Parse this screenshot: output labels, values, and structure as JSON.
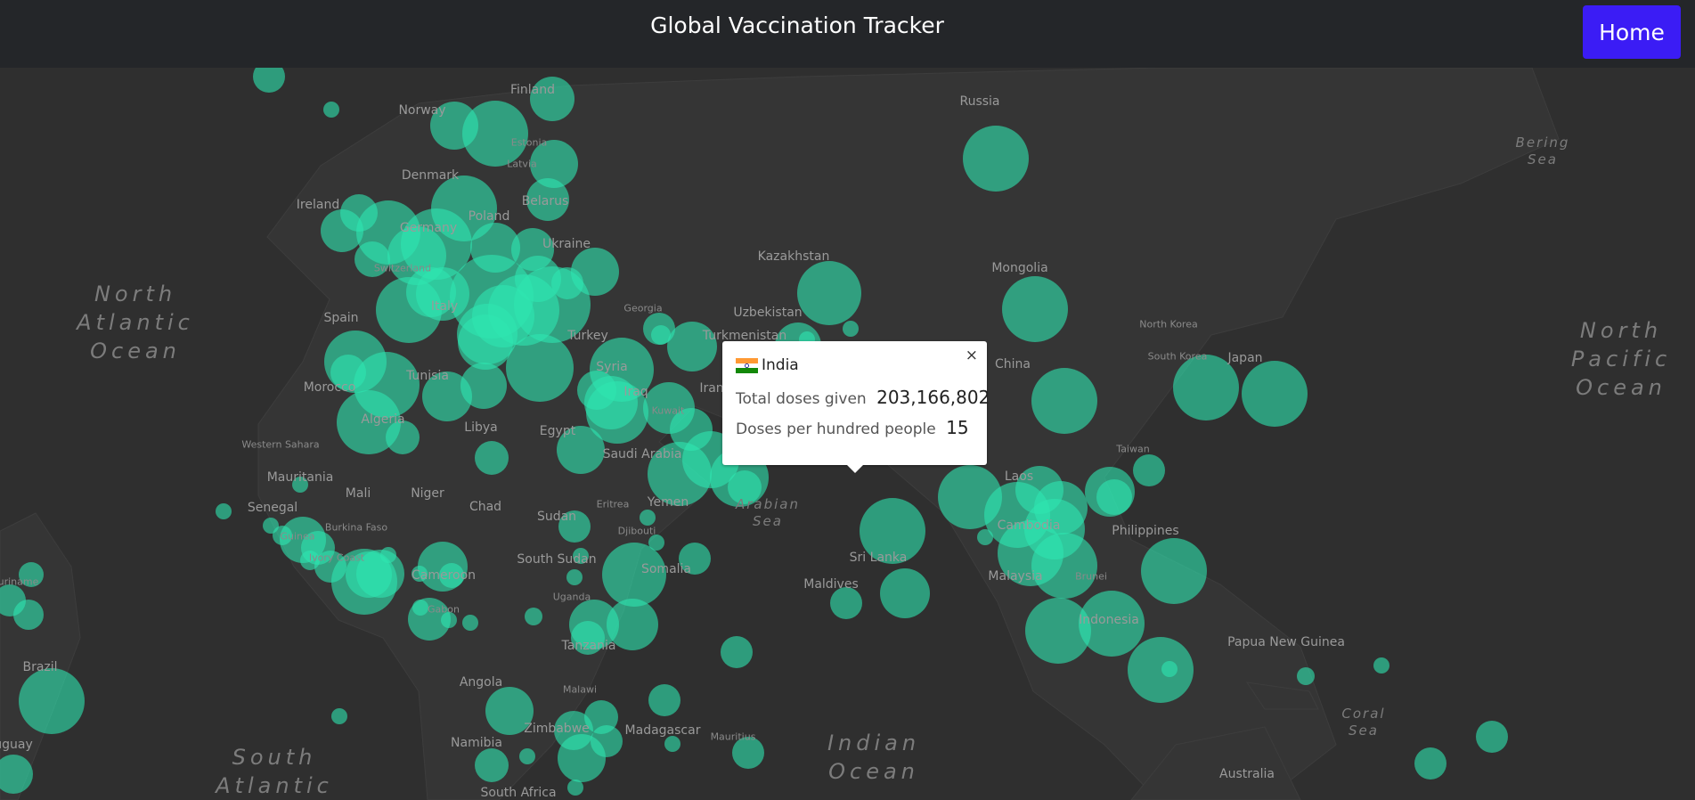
{
  "header": {
    "title": "Global Vaccination Tracker",
    "home_label": "Home"
  },
  "colors": {
    "bubble": "#2ee6b0",
    "accent": "#3b1cf5",
    "map_background": "#2f2f2f",
    "header_background": "#242629"
  },
  "map": {
    "country_labels": [
      "Finland",
      "Norway",
      "Estonia",
      "Latvia",
      "Denmark",
      "Belarus",
      "Ireland",
      "Poland",
      "Germany",
      "Ukraine",
      "Switzerland",
      "Italy",
      "Spain",
      "Georgia",
      "Turkey",
      "Turkmenistan",
      "Uzbekistan",
      "Kazakhstan",
      "Russia",
      "Mongolia",
      "China",
      "North Korea",
      "South Korea",
      "Japan",
      "Taiwan",
      "Morocco",
      "Tunisia",
      "Algeria",
      "Libya",
      "Egypt",
      "Syria",
      "Iraq",
      "Iran",
      "Kuwait",
      "Saudi Arabia",
      "Western Sahara",
      "Mauritania",
      "Mali",
      "Niger",
      "Chad",
      "Sudan",
      "Eritrea",
      "Yemen",
      "Djibouti",
      "Senegal",
      "Burkina Faso",
      "Guinea",
      "Ivory Coast",
      "Cameroon",
      "Gabon",
      "South Sudan",
      "Somalia",
      "Uganda",
      "Tanzania",
      "Malawi",
      "Angola",
      "Namibia",
      "Zimbabwe",
      "Madagascar",
      "Mauritius",
      "South Africa",
      "Brazil",
      "Suriname",
      "Uruguay",
      "Sri Lanka",
      "Maldives",
      "Laos",
      "Cambodia",
      "Malaysia",
      "Brunei",
      "Philippines",
      "Indonesia",
      "Papua New Guinea",
      "Australia"
    ],
    "ocean_labels": [
      "North Atlantic Ocean",
      "North Pacific Ocean",
      "South Atlantic",
      "Indian Ocean",
      "Arabian Sea",
      "Bering Sea",
      "Coral Sea"
    ]
  },
  "popup": {
    "country": "India",
    "flag": "india-flag",
    "close_symbol": "×",
    "doses_label": "Total doses given",
    "doses_value": "203,166,802",
    "per_hundred_label": "Doses per hundred people",
    "per_hundred_value": "15"
  }
}
